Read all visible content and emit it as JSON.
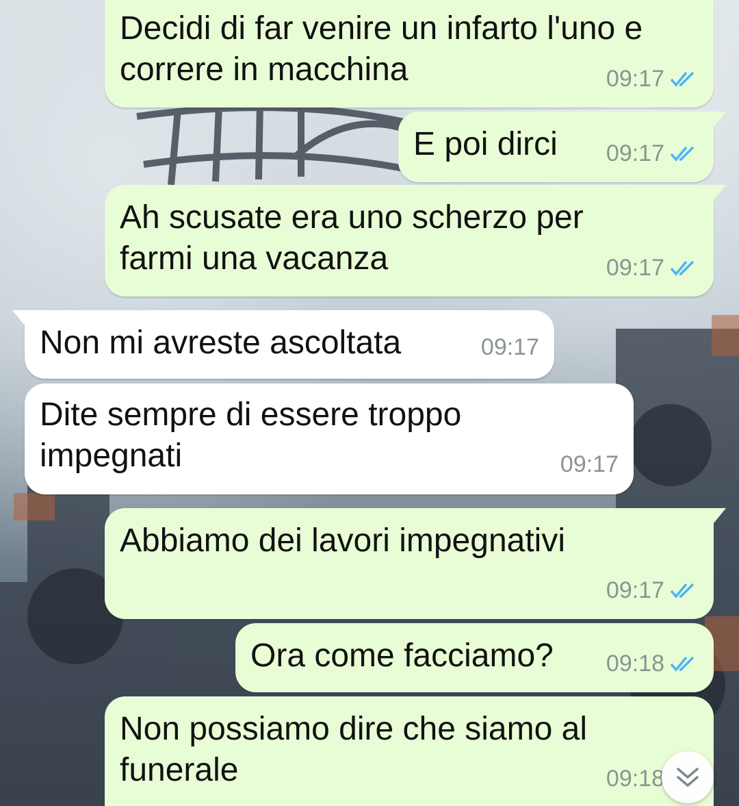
{
  "chat": {
    "messages": [
      {
        "direction": "out",
        "text": "Decidi di far venire un infarto l'uno e\ncorrere in macchina",
        "time": "09:17",
        "status": "read"
      },
      {
        "direction": "out",
        "text": "E poi dirci",
        "time": "09:17",
        "status": "read"
      },
      {
        "direction": "out",
        "text": "Ah scusate era uno scherzo per\nfarmi una vacanza",
        "time": "09:17",
        "status": "read"
      },
      {
        "direction": "in",
        "text": "Non mi avreste ascoltata",
        "time": "09:17"
      },
      {
        "direction": "in",
        "text": "Dite sempre di essere troppo\nimpegnati",
        "time": "09:17"
      },
      {
        "direction": "out",
        "text": "Abbiamo dei lavori impegnativi",
        "time": "09:17",
        "status": "read"
      },
      {
        "direction": "out",
        "text": "Ora come facciamo?",
        "time": "09:18",
        "status": "read"
      },
      {
        "direction": "out",
        "text": "Non possiamo dire che siamo al\nfunerale",
        "time": "09:18",
        "status": "read"
      }
    ]
  },
  "icons": {
    "read_receipt": "double-check-icon",
    "scroll_down": "chevron-double-down-icon"
  },
  "colors": {
    "outgoing_bubble": "#e8fdd6",
    "incoming_bubble": "#ffffff",
    "read_tick": "#4fb3f6",
    "timestamp": "#8a958f"
  }
}
